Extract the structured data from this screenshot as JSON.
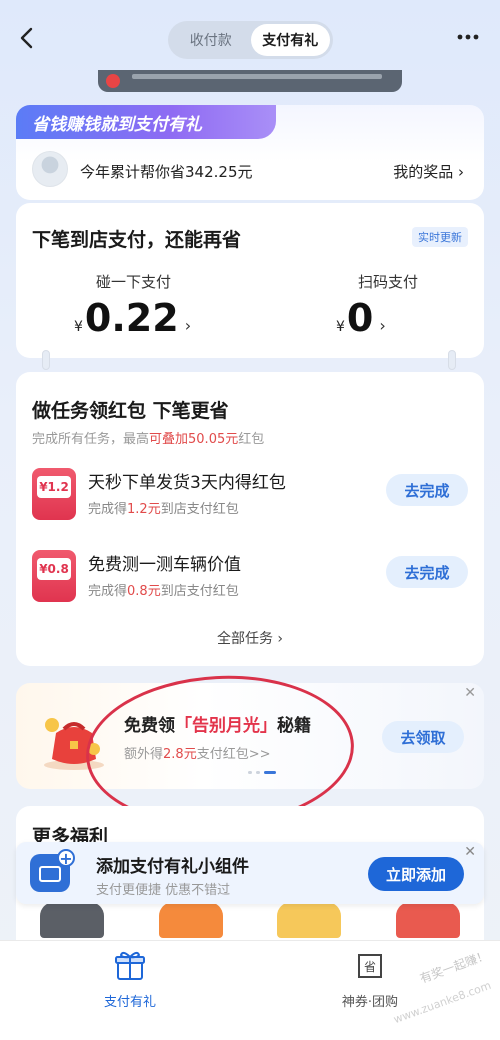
{
  "header": {
    "tabs": [
      "收付款",
      "支付有礼"
    ],
    "active_tab": "支付有礼"
  },
  "savings": {
    "slogan": "省钱赚钱就到支付有礼",
    "summary": "今年累计帮你省342.25元",
    "prizes_link": "我的奖品 ›"
  },
  "pay_section": {
    "title": "下笔到店支付，还能再省",
    "badge": "实时更新",
    "currency": "¥",
    "left": {
      "label": "碰一下支付",
      "amount": "0.22"
    },
    "right": {
      "label": "扫码支付",
      "amount": "0"
    }
  },
  "tasks": {
    "title": "做任务领红包 下笔更省",
    "subtitle_prefix": "完成所有任务，最高",
    "subtitle_highlight": "可叠加50.05元",
    "subtitle_suffix": "红包",
    "items": [
      {
        "badge": "¥1.2",
        "name": "天秒下单发货3天内得红包",
        "desc_prefix": "完成得",
        "desc_highlight": "1.2元",
        "desc_suffix": "到店支付红包",
        "button": "去完成"
      },
      {
        "badge": "¥0.8",
        "name": "免费测一测车辆价值",
        "desc_prefix": "完成得",
        "desc_highlight": "0.8元",
        "desc_suffix": "到店支付红包",
        "button": "去完成"
      }
    ],
    "all_link": "全部任务 ›"
  },
  "promo": {
    "title_prefix": "免费领",
    "title_highlight": "「告别月光」",
    "title_suffix": "秘籍",
    "sub_prefix": "额外得",
    "sub_highlight": "2.8元",
    "sub_suffix": "支付红包>>",
    "button": "去领取",
    "close": "✕"
  },
  "more": {
    "title": "更多福利"
  },
  "widget": {
    "title": "添加支付有礼小组件",
    "subtitle": "支付更便捷 优惠不错过",
    "button": "立即添加",
    "close": "✕"
  },
  "tabbar": {
    "left_label": "支付有礼",
    "right_label": "神券·团购"
  },
  "watermark": {
    "line1": "有奖一起赚！",
    "line2": "www.zuanke8.com"
  },
  "colors": {
    "accent_blue": "#1e67d8",
    "highlight_red": "#e14b4b",
    "annotation_red": "#d9324a"
  }
}
